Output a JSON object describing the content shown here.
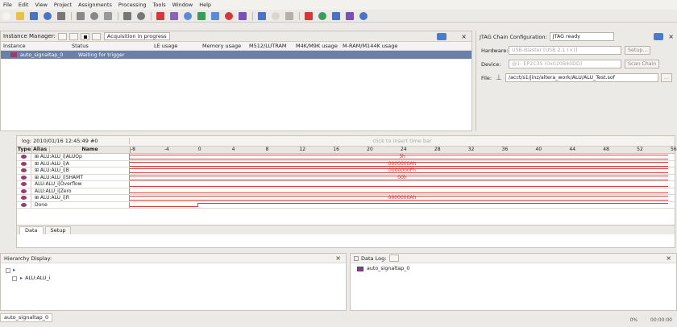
{
  "menu": [
    "File",
    "Edit",
    "View",
    "Project",
    "Assignments",
    "Processing",
    "Tools",
    "Window",
    "Help"
  ],
  "toolbar": {
    "icons": [
      "new-icon",
      "open-icon",
      "save-icon",
      "save-all-icon",
      "print-icon",
      "cut-icon",
      "copy-icon",
      "paste-icon",
      "undo-icon",
      "redo-icon",
      "compiler-icon",
      "timing-icon",
      "pin-icon",
      "analysis-icon",
      "synthesis-icon",
      "fitter-icon",
      "assembler-icon",
      "start-icon",
      "stop-icon",
      "analyze-icon",
      "chip-icon",
      "rtl-icon",
      "programmer-icon",
      "signaltap-icon",
      "help-icon"
    ]
  },
  "instance_manager": {
    "label": "Instance Manager:",
    "status": "Acquisition in progress",
    "columns": [
      "Instance",
      "Status",
      "LE usage",
      "Memory usage",
      "M512/LUTRAM",
      "M4K/M9K usage",
      "M-RAM/M144K usage"
    ],
    "rows": [
      {
        "instance": "auto_signaltap_0",
        "status": "Waiting for trigger"
      }
    ]
  },
  "jtag": {
    "title": "JTAG Chain Configuration:",
    "status": "JTAG ready",
    "hardware_label": "Hardware:",
    "hardware_value": "USB-Blaster [USB 2.1 (×)]",
    "setup_button": "Setup...",
    "device_label": "Device:",
    "device_value": "@1: EP2C35 (0x020B40DD)",
    "scan_button": "Scan Chain",
    "file_label": "File:",
    "file_value": "/acct/s1/jinz/altera_work/ALU/ALU_Test.sof",
    "browse_button": "..."
  },
  "waveform": {
    "log_label": "log: 2010/01/16 12:45:49  #0",
    "hint": "click to insert time bar",
    "ticks": [
      "-8",
      "-4",
      "0",
      "4",
      "8",
      "12",
      "16",
      "20",
      "24",
      "28",
      "32",
      "36",
      "40",
      "44",
      "48",
      "52",
      "56"
    ],
    "headers": {
      "type": "Type",
      "alias": "Alias",
      "name": "Name"
    },
    "signals": [
      {
        "name": "⊞ ALU:ALU_i|ALUOp",
        "value": "3h"
      },
      {
        "name": "⊞ ALU:ALU_i|A",
        "value": "0000000Ah"
      },
      {
        "name": "⊞ ALU:ALU_i|B",
        "value": "0000000Fh"
      },
      {
        "name": "⊞ ALU:ALU_i|SHAMT",
        "value": "00h"
      },
      {
        "name": "ALU:ALU_i|Overflow",
        "value": ""
      },
      {
        "name": "ALU:ALU_i|Zero",
        "value": ""
      },
      {
        "name": "⊞ ALU:ALU_i|R",
        "value": "0000000Ah"
      },
      {
        "name": "Done",
        "value": ""
      }
    ],
    "tabs": [
      "Data",
      "Setup"
    ]
  },
  "hierarchy": {
    "title": "Hierarchy Display:",
    "node": "ALU:ALU_i"
  },
  "datalog": {
    "title": "Data Log:",
    "entry": "auto_signaltap_0"
  },
  "bottom_tab": "auto_signaltap_0",
  "statusbar": {
    "progress": "0%",
    "time": "00:00:00"
  }
}
